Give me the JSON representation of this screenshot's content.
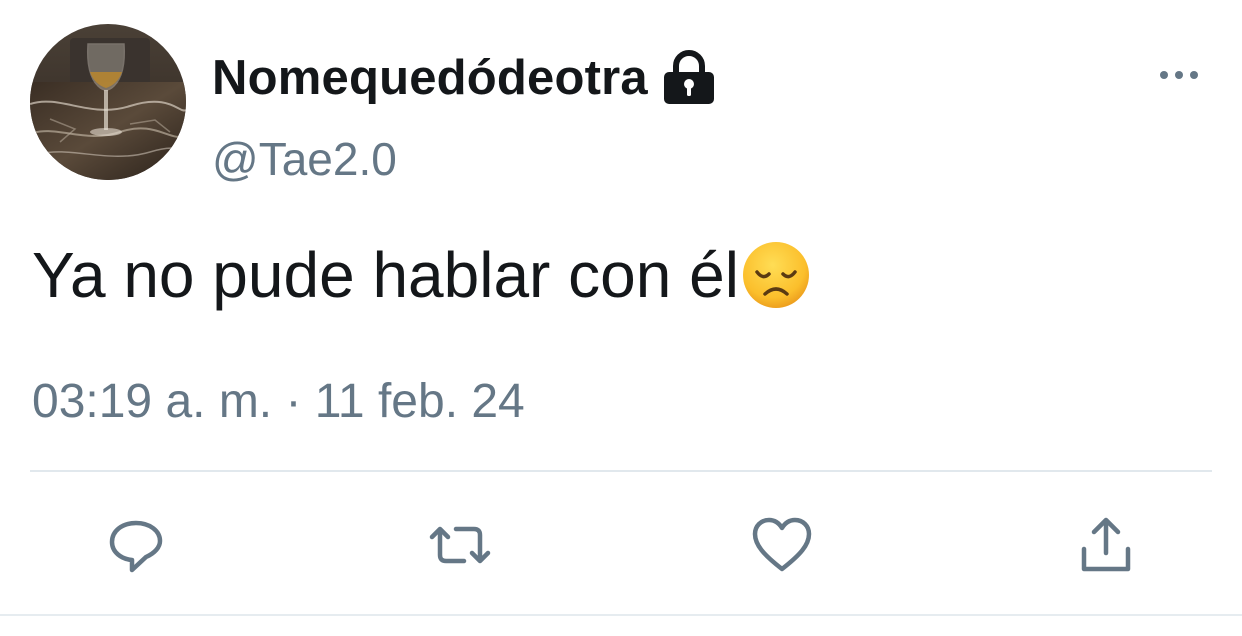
{
  "tweet": {
    "display_name": "Nomequedódeotra",
    "handle": "@Tae2.0",
    "text": "Ya no pude hablar con él",
    "emoji": "disappointed-face",
    "timestamp": "03:19 a. m. · 11 feb. 24"
  },
  "icons": {
    "lock": "lock-icon",
    "more": "more-options-icon",
    "reply": "reply-icon",
    "retweet": "retweet-icon",
    "like": "heart-icon",
    "share": "share-icon"
  },
  "colors": {
    "text": "#14171a",
    "secondary": "#657786",
    "divider": "#e1e8ed",
    "emoji_face": "#f7b733"
  }
}
